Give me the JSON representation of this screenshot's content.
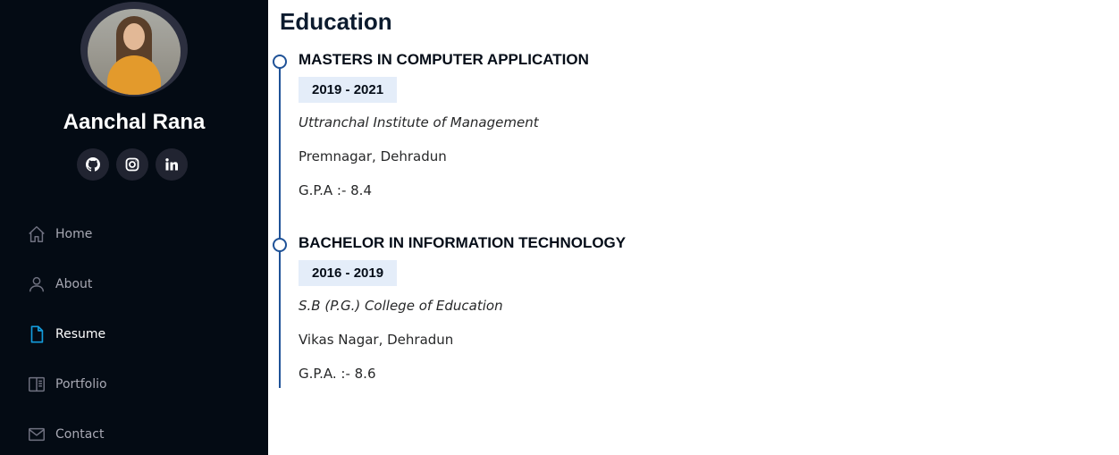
{
  "profile": {
    "name": "Aanchal Rana"
  },
  "socials": [
    {
      "icon": "github-icon"
    },
    {
      "icon": "instagram-icon"
    },
    {
      "icon": "linkedin-icon"
    }
  ],
  "nav": {
    "items": [
      {
        "label": "Home",
        "icon": "home-icon"
      },
      {
        "label": "About",
        "icon": "person-icon"
      },
      {
        "label": "Resume",
        "icon": "file-icon",
        "active": true
      },
      {
        "label": "Portfolio",
        "icon": "book-icon"
      },
      {
        "label": "Contact",
        "icon": "envelope-icon"
      }
    ]
  },
  "colors": {
    "sidebar_bg": "#040b14",
    "accent": "#1f5297",
    "active_nav_icon": "#149ddd",
    "years_bg": "#e4edf9"
  },
  "education": {
    "title": "Education",
    "items": [
      {
        "degree": "MASTERS IN COMPUTER APPLICATION",
        "years": "2019 - 2021",
        "institute": "Uttranchal Institute of Management",
        "location": "Premnagar, Dehradun",
        "gpa": "G.P.A :- 8.4"
      },
      {
        "degree": "BACHELOR IN INFORMATION TECHNOLOGY",
        "years": "2016 - 2019",
        "institute": "S.B (P.G.) College of Education",
        "location": "Vikas Nagar, Dehradun",
        "gpa": "G.P.A. :- 8.6"
      }
    ]
  }
}
